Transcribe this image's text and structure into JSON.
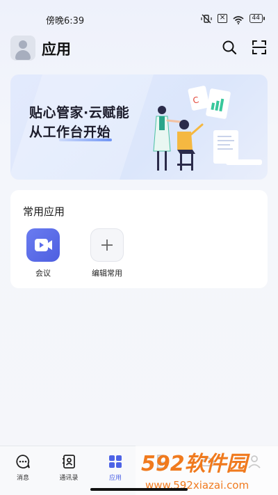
{
  "status_bar": {
    "time": "傍晚6:39",
    "battery": "44"
  },
  "header": {
    "title": "应用"
  },
  "banner": {
    "line1": "贴心管家·云赋能",
    "line2": "从工作台开始"
  },
  "common_apps": {
    "title": "常用应用",
    "items": [
      {
        "label": "会议",
        "icon": "video-camera-icon"
      },
      {
        "label": "编辑常用",
        "icon": "plus-icon"
      }
    ]
  },
  "tabbar": {
    "tabs": [
      {
        "label": "消息",
        "icon": "chat-bubble-icon",
        "active": false
      },
      {
        "label": "通讯录",
        "icon": "contacts-book-icon",
        "active": false
      },
      {
        "label": "应用",
        "icon": "apps-grid-icon",
        "active": true
      },
      {
        "label": "",
        "icon": "document-icon",
        "active": false
      },
      {
        "label": "",
        "icon": "cloud-icon",
        "active": false
      },
      {
        "label": "",
        "icon": "person-icon",
        "active": false
      }
    ]
  },
  "watermark": {
    "brand": "592软件园",
    "url": "www.592xiazai.com"
  },
  "colors": {
    "accent": "#4d63e6",
    "meeting_icon": "#5b6cec",
    "watermark_orange": "#f07a1e"
  }
}
